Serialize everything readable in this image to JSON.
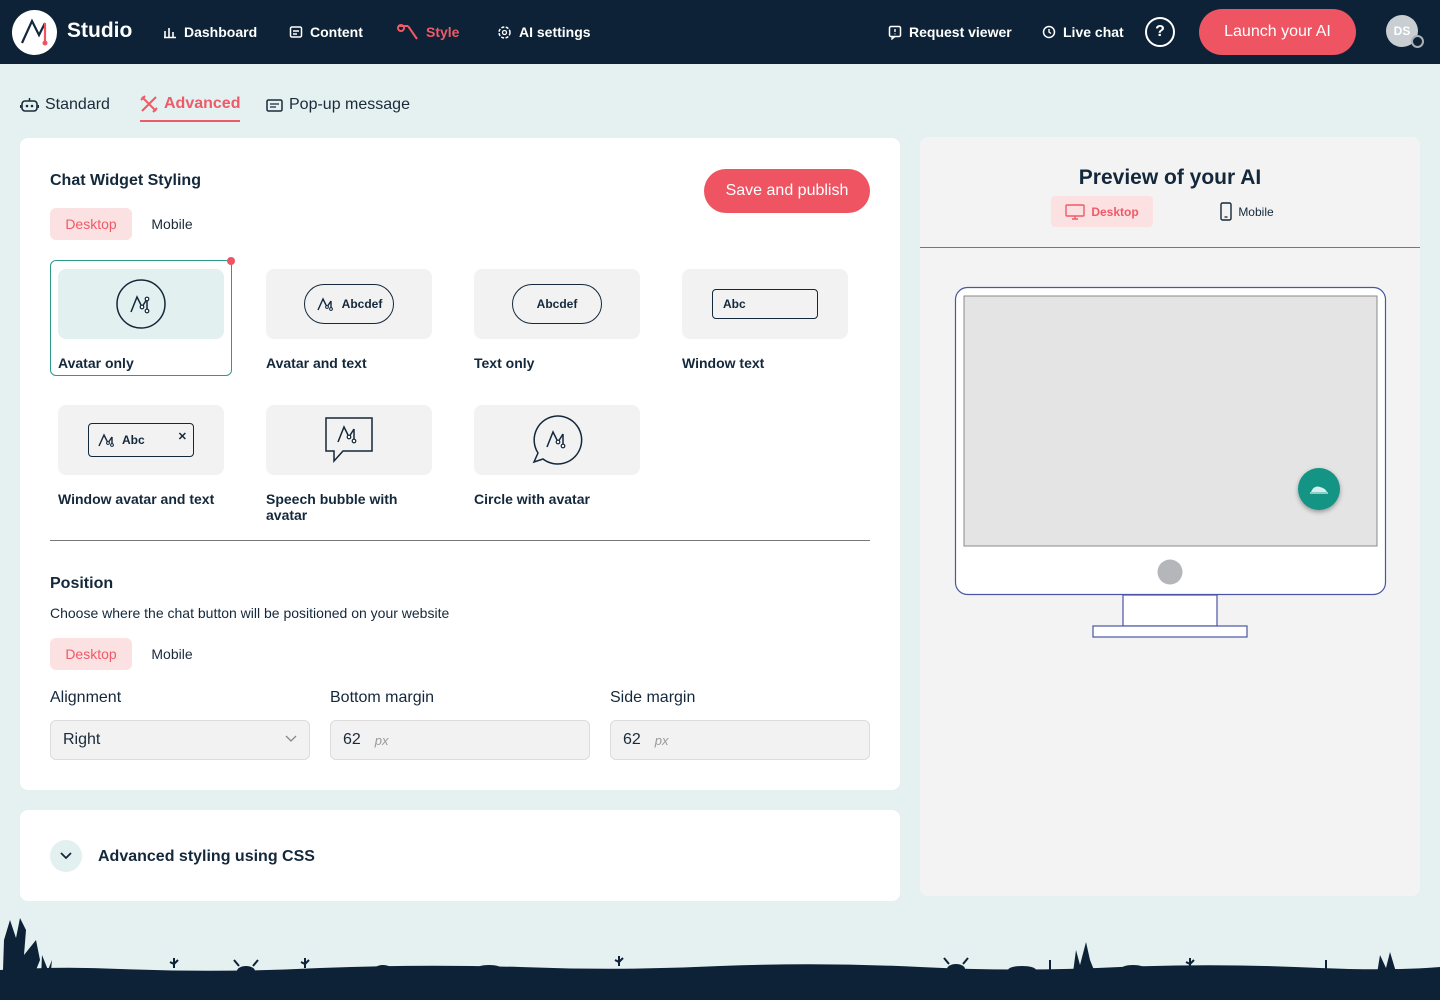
{
  "app": {
    "brand": "Studio"
  },
  "nav": {
    "dashboard": "Dashboard",
    "content": "Content",
    "style": "Style",
    "ai_settings": "AI settings",
    "request_viewer": "Request viewer",
    "live_chat": "Live chat",
    "help": "?",
    "launch": "Launch your AI",
    "user_initials": "DS"
  },
  "tabs": {
    "standard": "Standard",
    "advanced": "Advanced",
    "popup": "Pop-up message"
  },
  "styling": {
    "title": "Chat Widget Styling",
    "save": "Save and publish",
    "seg_desktop": "Desktop",
    "seg_mobile": "Mobile",
    "options": [
      {
        "label": "Avatar only",
        "sample": ""
      },
      {
        "label": "Avatar and text",
        "sample": "Abcdef"
      },
      {
        "label": "Text only",
        "sample": "Abcdef"
      },
      {
        "label": "Window text",
        "sample": "Abc"
      },
      {
        "label": "Window avatar and text",
        "sample": "Abc"
      },
      {
        "label": "Speech bubble with avatar",
        "sample": ""
      },
      {
        "label": "Circle with avatar",
        "sample": ""
      }
    ],
    "selected_option": "Avatar only"
  },
  "position": {
    "title": "Position",
    "description": "Choose where the chat button will be positioned on your website",
    "seg_desktop": "Desktop",
    "seg_mobile": "Mobile",
    "alignment_label": "Alignment",
    "alignment_value": "Right",
    "bottom_label": "Bottom margin",
    "bottom_value": "62",
    "side_label": "Side margin",
    "side_value": "62",
    "unit": "px"
  },
  "css_section": {
    "title": "Advanced styling using CSS"
  },
  "preview": {
    "title": "Preview of your AI",
    "desktop": "Desktop",
    "mobile": "Mobile"
  },
  "colors": {
    "accent": "#ee5462",
    "navy": "#0d2236",
    "teal": "#139484",
    "background": "#e4f1f0"
  }
}
